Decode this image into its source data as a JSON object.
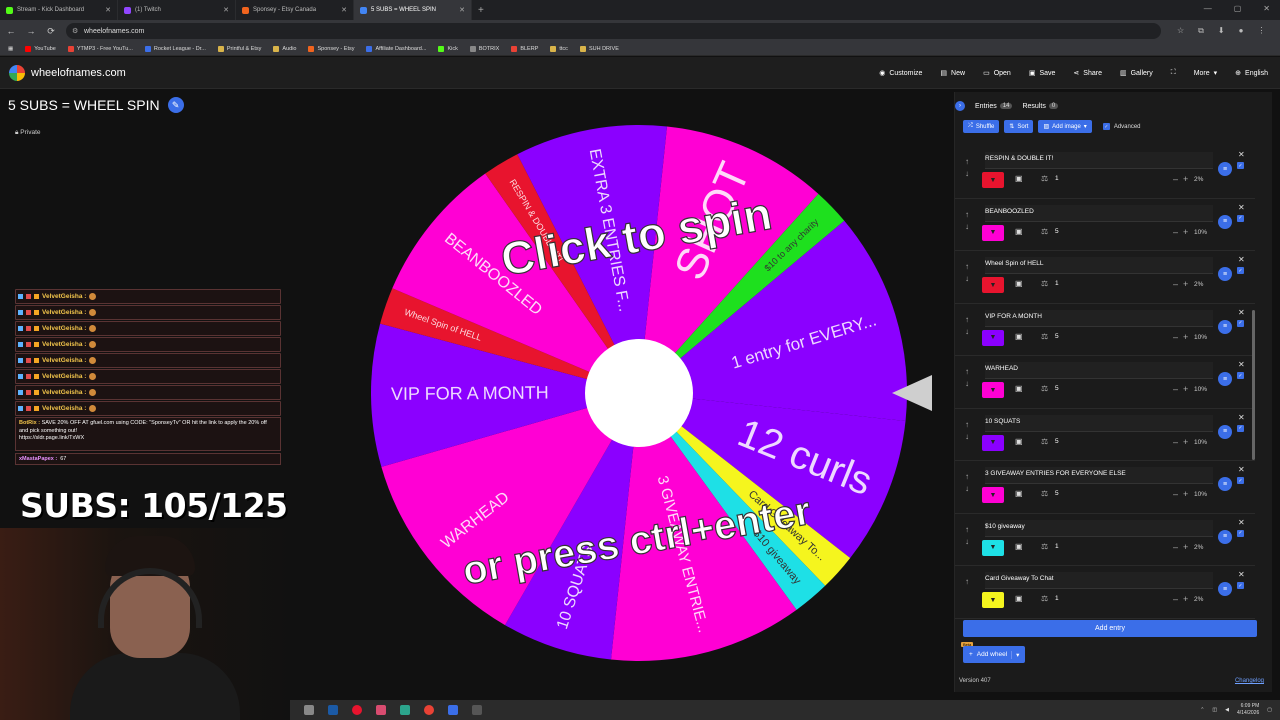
{
  "browser": {
    "tabs": [
      {
        "label": "Stream - Kick Dashboard",
        "color": "#53fc18"
      },
      {
        "label": "(1) Twitch",
        "color": "#9146ff"
      },
      {
        "label": "Sponsey - Etsy Canada",
        "color": "#f1641e"
      },
      {
        "label": "5 SUBS = WHEEL SPIN",
        "color": "#4285f4"
      }
    ],
    "url": "wheelofnames.com",
    "bookmarks": [
      {
        "label": "YouTube",
        "color": "#ff0000"
      },
      {
        "label": "YTMP3 - Free YouTu...",
        "color": "#e94235"
      },
      {
        "label": "Rocket League - Dr...",
        "color": "#3b6ee8"
      },
      {
        "label": "Printful & Etsy",
        "color": "#d9b44a"
      },
      {
        "label": "Audio",
        "color": "#d9b44a"
      },
      {
        "label": "Sponsey - Etsy",
        "color": "#f1641e"
      },
      {
        "label": "Affiliate Dashboard...",
        "color": "#3b6ee8"
      },
      {
        "label": "Kick",
        "color": "#53fc18"
      },
      {
        "label": "BOTRIX",
        "color": "#888888"
      },
      {
        "label": "BLERP",
        "color": "#e94235"
      },
      {
        "label": "ttcc",
        "color": "#d9b44a"
      },
      {
        "label": "SUH DRIVE",
        "color": "#d9b44a"
      }
    ]
  },
  "header": {
    "site_name": "wheelofnames.com",
    "menu": [
      {
        "label": "Customize",
        "icon": "palette-icon"
      },
      {
        "label": "New",
        "icon": "new-file-icon"
      },
      {
        "label": "Open",
        "icon": "folder-icon"
      },
      {
        "label": "Save",
        "icon": "save-icon"
      },
      {
        "label": "Share",
        "icon": "share-icon"
      },
      {
        "label": "Gallery",
        "icon": "gallery-icon"
      },
      {
        "label": "",
        "icon": "fullscreen-icon"
      },
      {
        "label": "More",
        "icon": "chevron-down-icon"
      },
      {
        "label": "English",
        "icon": "globe-icon"
      }
    ]
  },
  "wheel": {
    "title": "5 SUBS = WHEEL SPIN",
    "visibility": "Private",
    "overlay_top": "Click to spin",
    "overlay_bottom": "or press ctrl+enter",
    "segments": [
      {
        "label": "SHOT",
        "color": "#ff00d4"
      },
      {
        "label": "$10 to any charity",
        "color": "#1ee01e"
      },
      {
        "label": "1 entry for EVERY...",
        "color": "#8b00ff"
      },
      {
        "label": "12 curls",
        "color": "#8b00ff"
      },
      {
        "label": "Card Giveaway To...",
        "color": "#f5f51e"
      },
      {
        "label": "$10 giveaway",
        "color": "#1ee0e6"
      },
      {
        "label": "3 GIVEAWAY ENTRIE...",
        "color": "#ff00d4"
      },
      {
        "label": "10 SQUATS",
        "color": "#8b00ff"
      },
      {
        "label": "WARHEAD",
        "color": "#ff00d4"
      },
      {
        "label": "VIP FOR A MONTH",
        "color": "#8b00ff"
      },
      {
        "label": "Wheel Spin of HELL",
        "color": "#e8142e"
      },
      {
        "label": "BEANBOOZLED",
        "color": "#ff00d4"
      },
      {
        "label": "RESPIN & DOUBLE IT!",
        "color": "#e8142e"
      },
      {
        "label": "EXTRA 3 ENTRIES F...",
        "color": "#8b00ff"
      }
    ]
  },
  "stream": {
    "chat_user": "VelvetGeisha :",
    "chat_rows": 8,
    "botrix_name": "BotRix :",
    "botrix_msg": "SAVE 20% OFF AT gfuel.com using CODE: \"SponseyTv\" OR hit the link to apply the 20% off and pick something out!",
    "botrix_link": "https://sldr.page.link/TxWX",
    "last_user": "xMastaPapex :",
    "last_msg": "67",
    "subs_goal": "SUBS: 105/125"
  },
  "panel": {
    "tab_entries": "Entries",
    "entries_count": "14",
    "tab_results": "Results",
    "results_count": "0",
    "shuffle": "Shuffle",
    "sort": "Sort",
    "add_image": "Add image",
    "advanced": "Advanced",
    "entries": [
      {
        "name": "RESPIN & DOUBLE IT!",
        "color": "#e8142e",
        "weight": "1",
        "pct": "2%"
      },
      {
        "name": "BEANBOOZLED",
        "color": "#ff00d4",
        "weight": "5",
        "pct": "10%"
      },
      {
        "name": "Wheel Spin of HELL",
        "color": "#e8142e",
        "weight": "1",
        "pct": "2%"
      },
      {
        "name": "VIP FOR A MONTH",
        "color": "#8b00ff",
        "weight": "5",
        "pct": "10%"
      },
      {
        "name": "WARHEAD",
        "color": "#ff00d4",
        "weight": "5",
        "pct": "10%"
      },
      {
        "name": "10 SQUATS",
        "color": "#8b00ff",
        "weight": "5",
        "pct": "10%"
      },
      {
        "name": "3 GIVEAWAY ENTRIES FOR EVERYONE ELSE",
        "color": "#ff00d4",
        "weight": "5",
        "pct": "10%"
      },
      {
        "name": "$10 giveaway",
        "color": "#1ee0e6",
        "weight": "1",
        "pct": "2%"
      },
      {
        "name": "Card Giveaway To Chat",
        "color": "#f5f51e",
        "weight": "1",
        "pct": "2%"
      }
    ],
    "add_entry": "Add entry",
    "add_wheel": "Add wheel",
    "beta": "Beta",
    "version": "Version 407",
    "changelog": "Changelog"
  },
  "taskbar": {
    "time": "6:09 PM",
    "date": "4/14/2026"
  }
}
